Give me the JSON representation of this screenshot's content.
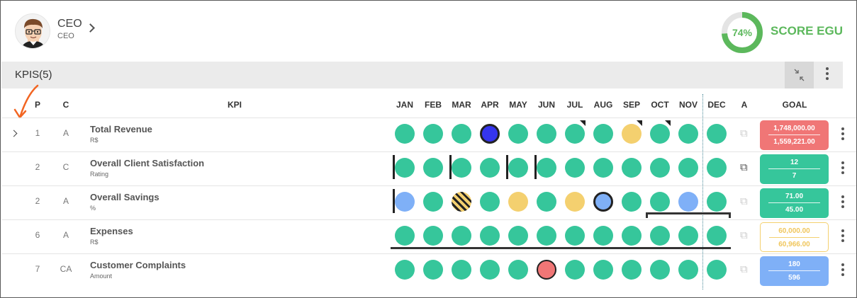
{
  "user": {
    "name": "CEO",
    "role": "CEO"
  },
  "score": {
    "percent": "74%",
    "value": 0.74,
    "label": "SCORE EGU"
  },
  "kpis_bar": {
    "title": "KPIS(5)"
  },
  "columns": {
    "p": "P",
    "c": "C",
    "kpi": "KPI",
    "a": "A",
    "goal": "GOAL",
    "months": [
      "JAN",
      "FEB",
      "MAR",
      "APR",
      "MAY",
      "JUN",
      "JUL",
      "AUG",
      "SEP",
      "OCT",
      "NOV",
      "DEC"
    ]
  },
  "rows": [
    {
      "p": "1",
      "c": "A",
      "name": "Total Revenue",
      "unit": "R$",
      "status": [
        "green",
        "green",
        "green",
        "blue-outline",
        "green",
        "green",
        "green",
        "green",
        "yellow",
        "green",
        "green",
        "green"
      ],
      "goal_target": "1,748,000.00",
      "goal_actual": "1,559,221.00",
      "goal_style": "red"
    },
    {
      "p": "2",
      "c": "C",
      "name": "Overall Client Satisfaction",
      "unit": "Rating",
      "status": [
        "green",
        "green",
        "green",
        "green",
        "green",
        "green",
        "green",
        "green",
        "green",
        "green",
        "green",
        "green"
      ],
      "goal_target": "12",
      "goal_actual": "7",
      "goal_style": "green"
    },
    {
      "p": "2",
      "c": "A",
      "name": "Overall Savings",
      "unit": "%",
      "status": [
        "light-blue",
        "green",
        "striped",
        "green",
        "yellow",
        "green",
        "yellow",
        "light-blue-outline",
        "green",
        "green",
        "light-blue",
        "green"
      ],
      "goal_target": "71.00",
      "goal_actual": "45.00",
      "goal_style": "green"
    },
    {
      "p": "6",
      "c": "A",
      "name": "Expenses",
      "unit": "R$",
      "status": [
        "green",
        "green",
        "green",
        "green",
        "green",
        "green",
        "green",
        "green",
        "green",
        "green",
        "green",
        "green"
      ],
      "goal_target": "60,000.00",
      "goal_actual": "60,966.00",
      "goal_style": "outline"
    },
    {
      "p": "7",
      "c": "CA",
      "name": "Customer Complaints",
      "unit": "Amount",
      "status": [
        "green",
        "green",
        "green",
        "green",
        "green",
        "red-outline",
        "green",
        "green",
        "green",
        "green",
        "green",
        "green"
      ],
      "goal_target": "180",
      "goal_actual": "596",
      "goal_style": "blue"
    }
  ],
  "colors": {
    "green": "#36c69b",
    "score_green": "#5cb85c",
    "red": "#f07676",
    "yellow": "#f4d06f",
    "light_blue": "#7fb0f7",
    "blue": "#3535ee",
    "annotation_orange": "#f26522"
  },
  "icons": [
    "chevron-right-icon",
    "collapse-icon",
    "more-vertical-icon",
    "paperclip-icon",
    "avatar-icon"
  ]
}
